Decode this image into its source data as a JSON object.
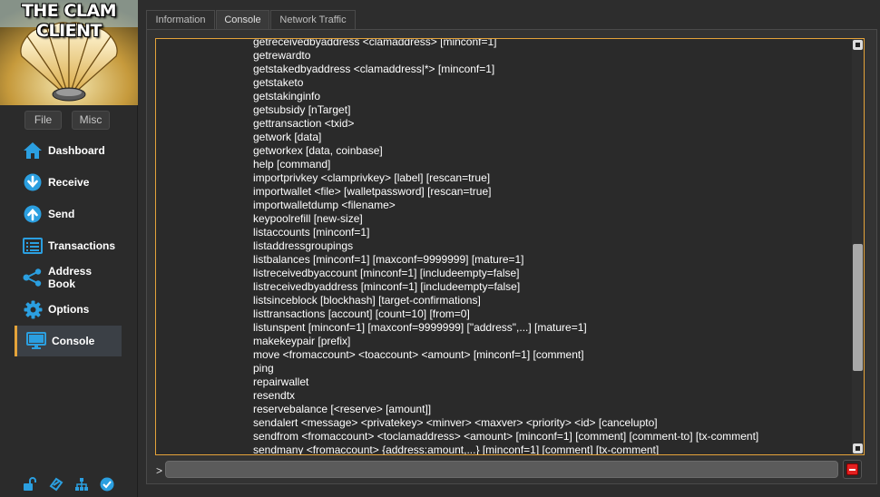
{
  "app": {
    "logo_text": "THE CLAM CLIENT"
  },
  "sidebar": {
    "menu": [
      {
        "label": "File"
      },
      {
        "label": "Misc"
      }
    ],
    "nav": [
      {
        "label": "Dashboard",
        "icon": "home-icon"
      },
      {
        "label": "Receive",
        "icon": "download-arrow-icon"
      },
      {
        "label": "Send",
        "icon": "upload-arrow-icon"
      },
      {
        "label": "Transactions",
        "icon": "list-icon"
      },
      {
        "label": "Address Book",
        "icon": "share-icon"
      },
      {
        "label": "Options",
        "icon": "gear-icon"
      },
      {
        "label": "Console",
        "icon": "monitor-icon",
        "active": true
      }
    ],
    "status_icons": [
      "unlocked-icon",
      "staking-icon",
      "network-icon",
      "synced-check-icon"
    ]
  },
  "tabs": [
    {
      "label": "Information"
    },
    {
      "label": "Console",
      "active": true
    },
    {
      "label": "Network Traffic"
    }
  ],
  "console": {
    "lines": [
      "getreceivedbyaddress <clamaddress> [minconf=1]",
      "getrewardto",
      "getstakedbyaddress <clamaddress|*> [minconf=1]",
      "getstaketo",
      "getstakinginfo",
      "getsubsidy [nTarget]",
      "gettransaction <txid>",
      "getwork [data]",
      "getworkex [data, coinbase]",
      "help [command]",
      "importprivkey <clamprivkey> [label] [rescan=true]",
      "importwallet <file> [walletpassword] [rescan=true]",
      "importwalletdump <filename>",
      "keypoolrefill [new-size]",
      "listaccounts [minconf=1]",
      "listaddressgroupings",
      "listbalances [minconf=1] [maxconf=9999999] [mature=1]",
      "listreceivedbyaccount [minconf=1] [includeempty=false]",
      "listreceivedbyaddress [minconf=1] [includeempty=false]",
      "listsinceblock [blockhash] [target-confirmations]",
      "listtransactions [account] [count=10] [from=0]",
      "listunspent [minconf=1] [maxconf=9999999] [\"address\",...] [mature=1]",
      "makekeypair [prefix]",
      "move <fromaccount> <toaccount> <amount> [minconf=1] [comment]",
      "ping",
      "repairwallet",
      "resendtx",
      "reservebalance [<reserve> [amount]]",
      "sendalert <message> <privatekey> <minver> <maxver> <priority> <id> [cancelupto]",
      "sendfrom <fromaccount> <toclamaddress> <amount> [minconf=1] [comment] [comment-to] [tx-comment]",
      "sendmany <fromaccount> {address:amount,...} [minconf=1] [comment] [tx-comment]"
    ],
    "prompt": ">",
    "input_value": ""
  },
  "colors": {
    "accent": "#e4a33a",
    "nav_icon": "#2b9fe0",
    "clear_button": "#e32020"
  }
}
